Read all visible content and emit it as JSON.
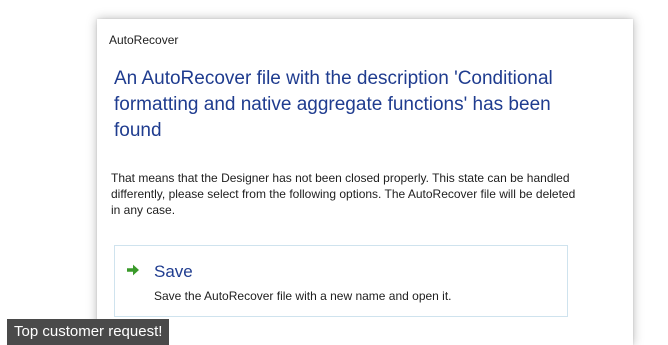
{
  "window": {
    "title": "AutoRecover"
  },
  "dialog": {
    "headline": "An AutoRecover file with the description 'Conditional formatting and native aggregate functions' has been found",
    "description": "That means that the Designer has not been closed properly. This state can be handled differently, please select from the following options. The AutoRecover file will be deleted in any case."
  },
  "options": [
    {
      "icon": "green-arrow-right-icon",
      "title": "Save",
      "subtitle": "Save the AutoRecover file with a new name and open it."
    }
  ],
  "caption": {
    "text": "Top customer request!"
  },
  "colors": {
    "headline": "#1f3c8f",
    "icon_green": "#3a9a2a",
    "card_border": "#cfe3ee",
    "caption_bg": "#4a4a4a"
  }
}
